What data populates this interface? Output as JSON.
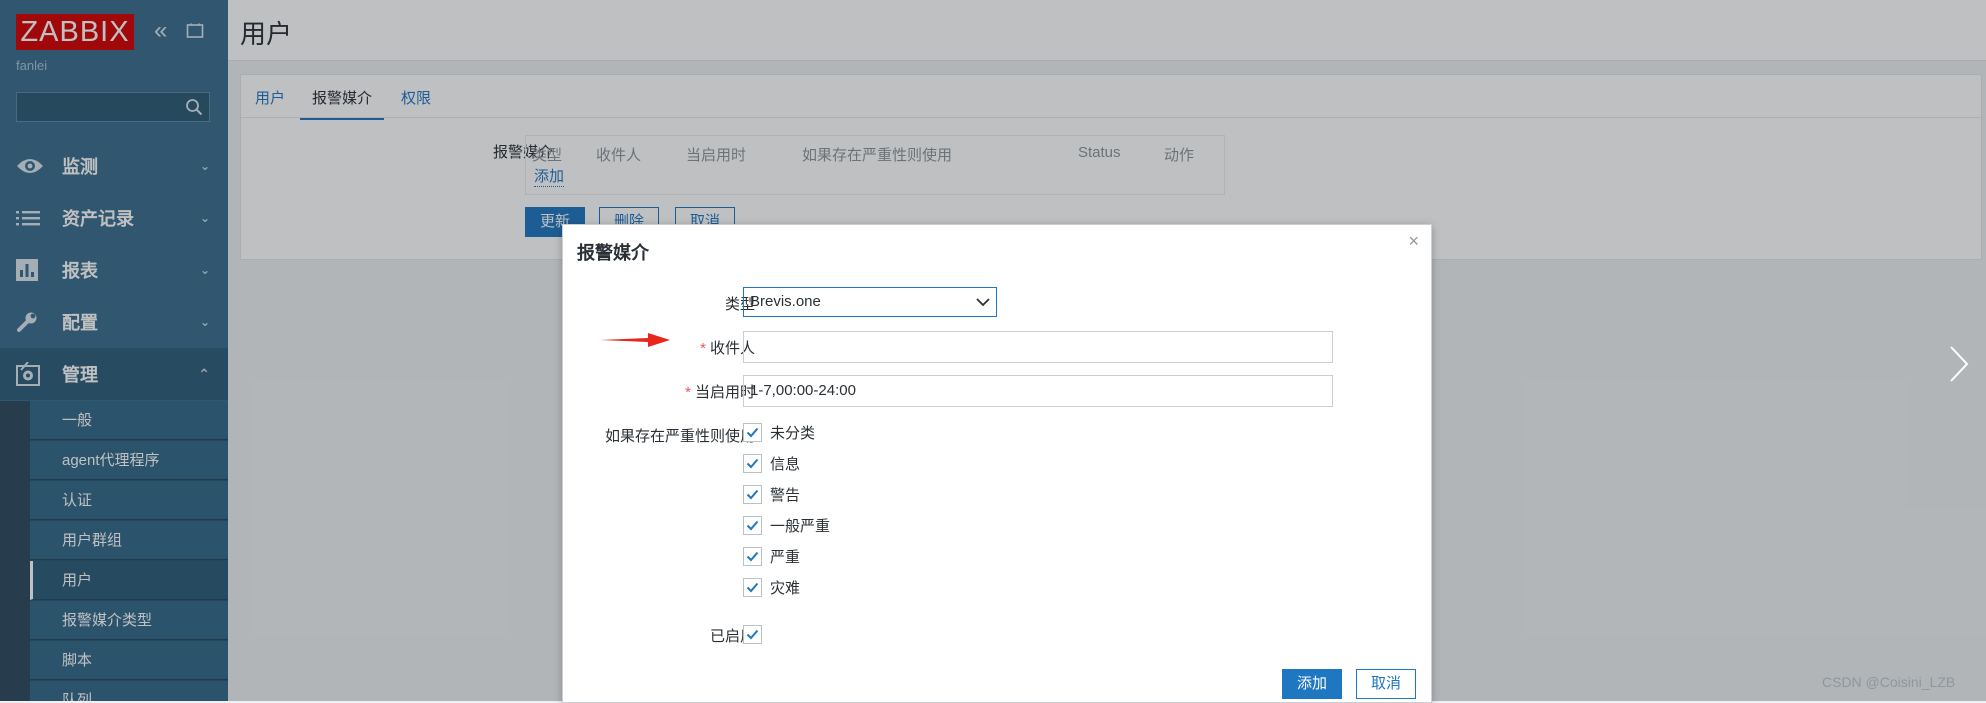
{
  "brand": {
    "logo": "ZABBIX",
    "user": "fanlei"
  },
  "nav": [
    {
      "label": "监测",
      "icon": "eye-icon",
      "expanded": false
    },
    {
      "label": "资产记录",
      "icon": "list-icon",
      "expanded": false
    },
    {
      "label": "报表",
      "icon": "bar-chart-icon",
      "expanded": false
    },
    {
      "label": "配置",
      "icon": "wrench-icon",
      "expanded": false
    },
    {
      "label": "管理",
      "icon": "gear-icon",
      "expanded": true
    }
  ],
  "admin_menu": [
    "一般",
    "agent代理程序",
    "认证",
    "用户群组",
    "用户",
    "报警媒介类型",
    "脚本",
    "队列"
  ],
  "page": {
    "title": "用户",
    "tabs": [
      "用户",
      "报警媒介",
      "权限"
    ],
    "media_label": "报警媒介",
    "media_columns": [
      "类型",
      "收件人",
      "当启用时",
      "如果存在严重性则使用",
      "Status",
      "动作"
    ],
    "media_add": "添加",
    "buttons": {
      "update": "更新",
      "delete": "删除",
      "cancel": "取消"
    }
  },
  "modal": {
    "title": "报警媒介",
    "type_label": "类型",
    "type_value": "Brevis.one",
    "sendto_label": "收件人",
    "sendto_value": "",
    "period_label": "当启用时",
    "period_value": "1-7,00:00-24:00",
    "severity_label": "如果存在严重性则使用",
    "severities": [
      {
        "label": "未分类",
        "checked": true
      },
      {
        "label": "信息",
        "checked": true
      },
      {
        "label": "警告",
        "checked": true
      },
      {
        "label": "一般严重",
        "checked": true
      },
      {
        "label": "严重",
        "checked": true
      },
      {
        "label": "灾难",
        "checked": true
      }
    ],
    "enabled_label": "已启用",
    "enabled": true,
    "add_button": "添加",
    "cancel_button": "取消"
  },
  "watermark": "CSDN @Coisini_LZB",
  "colors": {
    "sidebar": "#3a6e8c",
    "accent": "#1f77c2",
    "logo": "#d40000",
    "annotation_arrow": "#e8271c"
  }
}
